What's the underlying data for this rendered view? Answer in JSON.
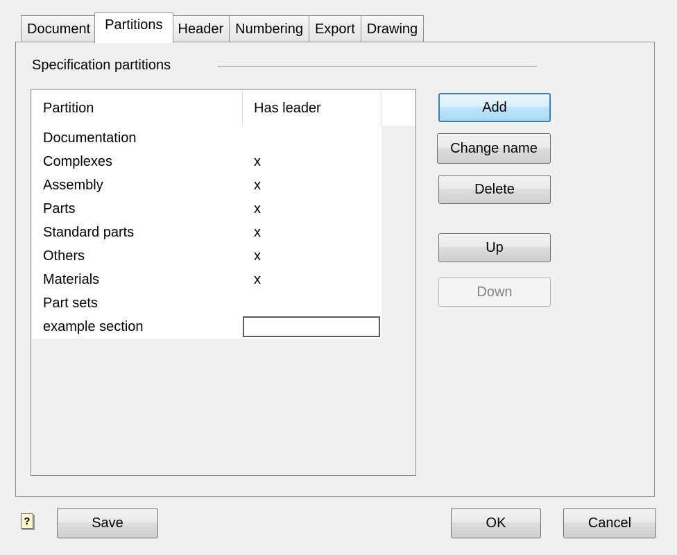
{
  "tabs": [
    "Document",
    "Partitions",
    "Header",
    "Numbering",
    "Export",
    "Drawing"
  ],
  "active_tab": "Partitions",
  "group_label": "Specification partitions",
  "list": {
    "columns": [
      "Partition",
      "Has leader"
    ],
    "rows": [
      {
        "name": "Documentation",
        "leader": ""
      },
      {
        "name": "Complexes",
        "leader": "x"
      },
      {
        "name": "Assembly",
        "leader": "x"
      },
      {
        "name": "Parts",
        "leader": "x"
      },
      {
        "name": "Standard parts",
        "leader": "x"
      },
      {
        "name": "Others",
        "leader": "x"
      },
      {
        "name": "Materials",
        "leader": "x"
      },
      {
        "name": "Part sets",
        "leader": ""
      },
      {
        "name": "example section",
        "leader": "",
        "editing": true
      }
    ]
  },
  "buttons": {
    "add": "Add",
    "change_name": "Change name",
    "delete": "Delete",
    "up": "Up",
    "down": "Down",
    "save": "Save",
    "ok": "OK",
    "cancel": "Cancel"
  },
  "help_icon_glyph": "?",
  "icons": {
    "help": "help-icon"
  },
  "colors": {
    "default_button_border": "#3c7fb1",
    "background": "#f0f0f0"
  }
}
